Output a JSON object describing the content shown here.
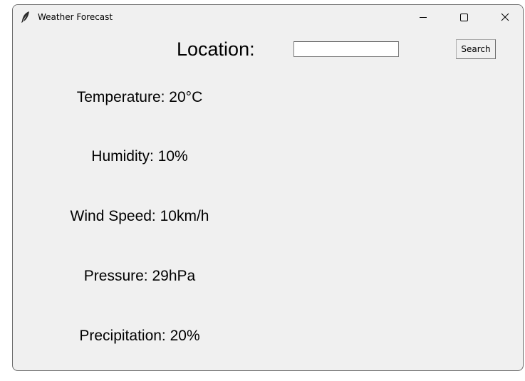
{
  "window": {
    "title": "Weather Forecast",
    "icons": {
      "app": "feather-icon",
      "minimize": "minimize-icon",
      "maximize": "maximize-icon",
      "close": "close-icon"
    }
  },
  "search": {
    "label": "Location:",
    "value": "",
    "button_label": "Search"
  },
  "weather": {
    "temperature": "Temperature: 20°C",
    "humidity": "Humidity: 10%",
    "wind_speed": "Wind Speed: 10km/h",
    "pressure": "Pressure: 29hPa",
    "precipitation": "Precipitation: 20%"
  }
}
